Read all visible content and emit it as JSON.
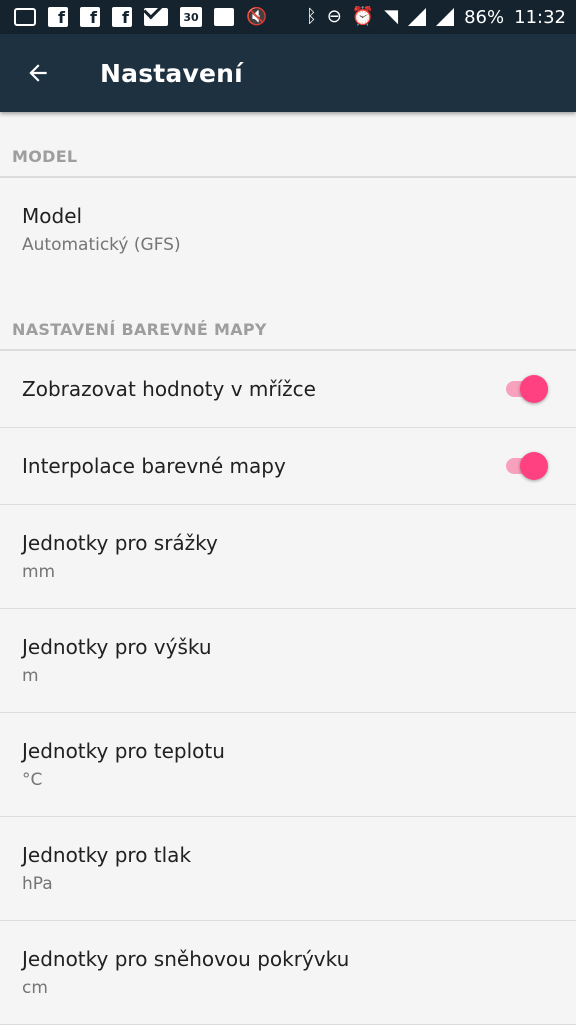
{
  "status_bar": {
    "battery": "86%",
    "time": "11:32",
    "calendar_day": "30",
    "icons": [
      "chat-icon",
      "facebook-icon",
      "facebook-icon",
      "facebook-icon",
      "gmail-icon",
      "calendar-icon",
      "gallery-icon",
      "mute-icon",
      "bluetooth-icon",
      "do-not-disturb-icon",
      "alarm-icon",
      "wifi-icon",
      "signal-icon",
      "signal-icon",
      "battery-icon"
    ]
  },
  "app_bar": {
    "title": "Nastavení",
    "back_icon": "arrow-left-icon"
  },
  "sections": [
    {
      "header": "MODEL",
      "items": [
        {
          "title": "Model",
          "summary": "Automatický (GFS)"
        }
      ]
    },
    {
      "header": "NASTAVENÍ BAREVNÉ MAPY",
      "toggles": [
        {
          "title": "Zobrazovat hodnoty v mřížce",
          "checked": true
        },
        {
          "title": "Interpolace barevné mapy",
          "checked": true
        }
      ],
      "items": [
        {
          "title": "Jednotky pro srážky",
          "summary": "mm"
        },
        {
          "title": "Jednotky pro výšku",
          "summary": "m"
        },
        {
          "title": "Jednotky pro teplotu",
          "summary": "°C"
        },
        {
          "title": "Jednotky pro tlak",
          "summary": "hPa"
        },
        {
          "title": "Jednotky pro sněhovou pokrývku",
          "summary": "cm"
        }
      ]
    }
  ],
  "colors": {
    "accent": "#ff4081",
    "app_bar": "#1e3140",
    "status_bar": "#14232d"
  }
}
